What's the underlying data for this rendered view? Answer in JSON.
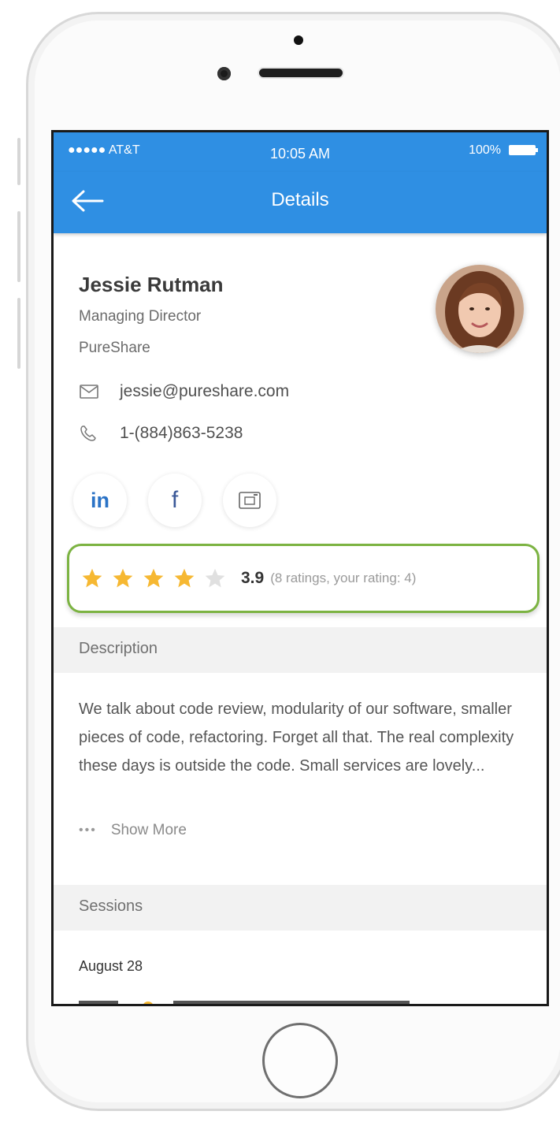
{
  "status": {
    "carrier": "●●●●● AT&T",
    "time": "10:05 AM",
    "battery": "100%"
  },
  "nav": {
    "title": "Details"
  },
  "profile": {
    "name": "Jessie Rutman",
    "title": "Managing Director",
    "company": "PureShare",
    "email": "jessie@pureshare.com",
    "phone": "1-(884)863-5238"
  },
  "socials": {
    "linkedin": "in",
    "facebook": "f"
  },
  "rating": {
    "stars": 4,
    "max_stars": 5,
    "value": "3.9",
    "info": "(8 ratings, your rating: 4)",
    "star_color": "#f6b832",
    "empty_star_color": "#e0e0e0",
    "border_color": "#7cb342"
  },
  "description": {
    "header": "Description",
    "text": "We talk about code review, modularity of our software, smaller pieces of code, refactoring. Forget all that. The real complexity these days is outside the code. Small services are lovely...",
    "show_more": "Show More"
  },
  "sessions": {
    "header": "Sessions",
    "date": "August 28"
  },
  "colors": {
    "primary": "#2f8fe3"
  }
}
